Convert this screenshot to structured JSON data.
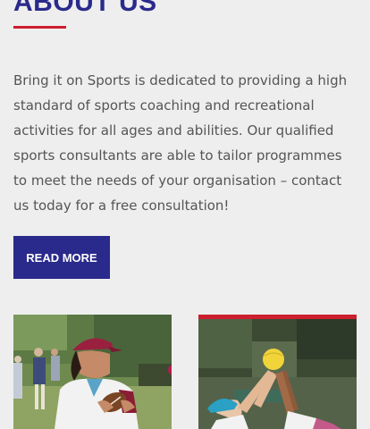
{
  "about": {
    "heading": "ABOUT US",
    "intro": "Bring it on Sports is dedicated to providing a high standard of sports coaching and recreational activities for all ages and abilities. Our qualified sports consultants are able to tailor programmes to meet the needs of your organisation – contact us today for a free consultation!",
    "cta_label": "READ MORE"
  },
  "gallery": [
    {
      "name": "rugby-player-photo"
    },
    {
      "name": "netball-players-photo"
    }
  ],
  "colors": {
    "brand_blue": "#2a2a8c",
    "accent_red": "#cc1f2f",
    "background": "#eeeeee",
    "body_text": "#555555"
  }
}
